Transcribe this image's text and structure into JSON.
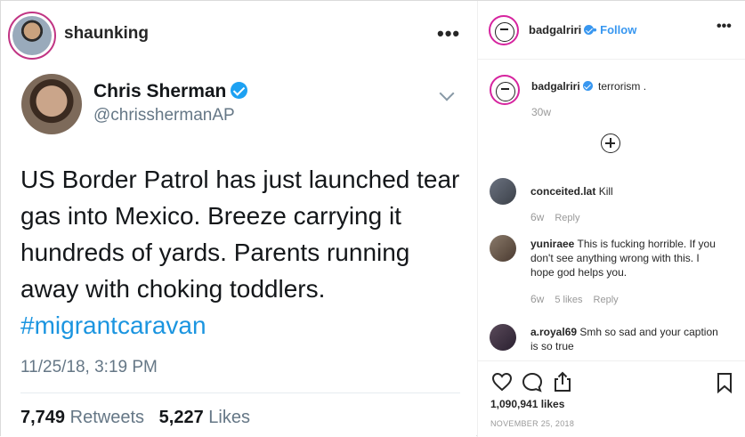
{
  "left_post": {
    "username": "shaunking",
    "menu_icon": "more-dots-icon"
  },
  "tweet": {
    "name": "Chris Sherman",
    "handle": "@chrisshermanAP",
    "text_line1": "US Border Patrol has just launched tear",
    "text_line2": "gas into Mexico. Breeze carrying it",
    "text_line3": "hundreds of yards. Parents running",
    "text_line4": "away with choking toddlers.",
    "hashtag": "#migrantcaravan",
    "timestamp": "11/25/18, 3:19 PM",
    "retweets_count": "7,749",
    "retweets_label": "Retweets",
    "likes_count": "5,227",
    "likes_label": "Likes"
  },
  "sidebar": {
    "username": "badgalriri",
    "follow_label": "• Follow",
    "caption_text": "terrorism .",
    "caption_time": "30w",
    "comments": [
      {
        "user": "conceited.lat",
        "text": "Kill",
        "time": "6w",
        "reply_label": "Reply"
      },
      {
        "user": "yuniraee",
        "text": "This is fucking horrible. If you don't see anything wrong with this. I hope god helps you.",
        "time": "6w",
        "likes": "5 likes",
        "reply_label": "Reply"
      },
      {
        "user": "a.royal69",
        "text": "Smh so sad and your caption is so true"
      }
    ],
    "likes_count": "1,090,941 likes",
    "post_date": "NOVEMBER 25, 2018"
  },
  "colors": {
    "twitter_blue": "#1da1f2",
    "hashtag_blue": "#1b95e0",
    "instagram_blue": "#3897f0",
    "muted_gray": "#657786"
  }
}
